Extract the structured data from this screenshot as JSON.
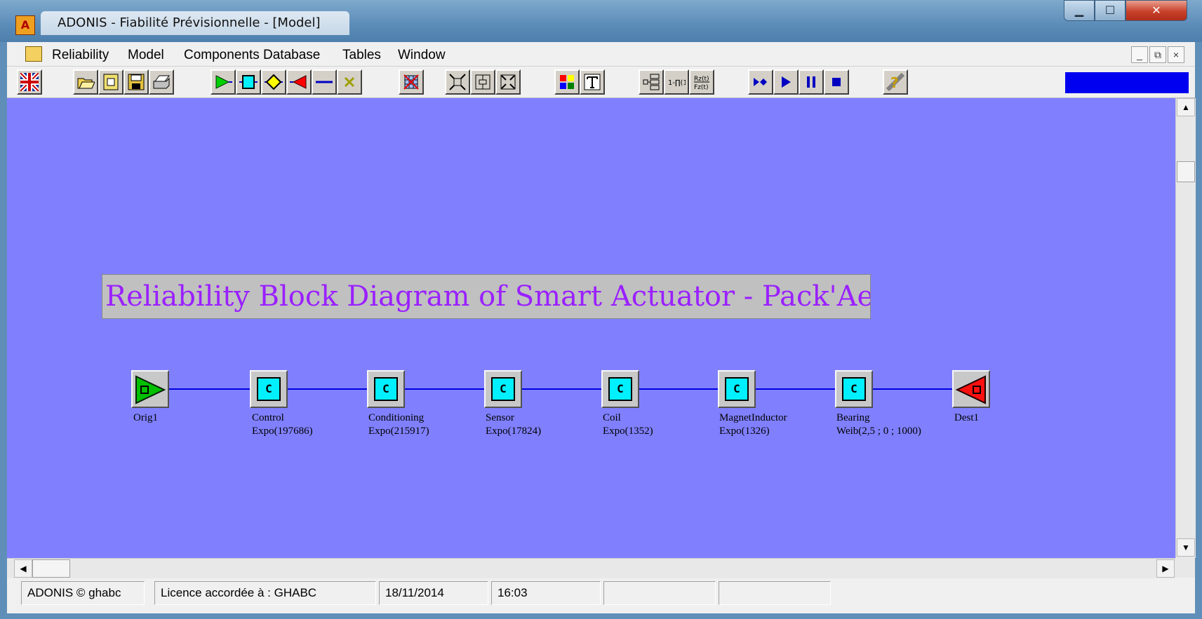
{
  "window": {
    "title": "ADONIS - Fiabilité Prévisionnelle - [Model]"
  },
  "menubar": {
    "items": [
      "Reliability",
      "Model",
      "Components Database",
      "Tables",
      "Window"
    ]
  },
  "toolbar": {
    "buttons": [
      {
        "name": "language-flag-button",
        "icon": "uk-flag-icon"
      },
      {
        "name": "open-button",
        "icon": "open-folder-icon"
      },
      {
        "name": "new-button",
        "icon": "new-document-icon"
      },
      {
        "name": "save-button",
        "icon": "floppy-disk-icon"
      },
      {
        "name": "print-button",
        "icon": "printer-icon"
      },
      {
        "name": "origin-tool-button",
        "icon": "origin-triangle-icon"
      },
      {
        "name": "component-tool-button",
        "icon": "component-square-icon"
      },
      {
        "name": "node-tool-button",
        "icon": "diamond-node-icon"
      },
      {
        "name": "destination-tool-button",
        "icon": "destination-triangle-icon"
      },
      {
        "name": "link-tool-button",
        "icon": "link-line-icon"
      },
      {
        "name": "delete-button",
        "icon": "delete-x-icon"
      },
      {
        "name": "delete-all-button",
        "icon": "grid-delete-icon"
      },
      {
        "name": "zoom-in-button",
        "icon": "zoom-in-icon"
      },
      {
        "name": "center-button",
        "icon": "center-icon"
      },
      {
        "name": "zoom-out-button",
        "icon": "zoom-out-icon"
      },
      {
        "name": "colors-button",
        "icon": "color-palette-icon"
      },
      {
        "name": "text-button",
        "icon": "text-t-icon"
      },
      {
        "name": "structure-button",
        "icon": "structure-icon"
      },
      {
        "name": "function-button",
        "icon": "function-icon"
      },
      {
        "name": "reliability-functions-button",
        "icon": "rz-fz-icon"
      },
      {
        "name": "step-button",
        "icon": "step-icon"
      },
      {
        "name": "play-button",
        "icon": "play-icon"
      },
      {
        "name": "pause-button",
        "icon": "pause-icon"
      },
      {
        "name": "stop-button",
        "icon": "stop-icon"
      },
      {
        "name": "help-button",
        "icon": "help-question-icon"
      }
    ]
  },
  "diagram": {
    "title": "Reliability Block Diagram of Smart Actuator - Pack'Aero",
    "blocks": [
      {
        "type": "origin",
        "name": "Orig1",
        "law": ""
      },
      {
        "type": "component",
        "symbol": "C",
        "name": "Control",
        "law": "Expo(197686)"
      },
      {
        "type": "component",
        "symbol": "C",
        "name": "Conditioning",
        "law": "Expo(215917)"
      },
      {
        "type": "component",
        "symbol": "C",
        "name": "Sensor",
        "law": "Expo(17824)"
      },
      {
        "type": "component",
        "symbol": "C",
        "name": "Coil",
        "law": "Expo(1352)"
      },
      {
        "type": "component",
        "symbol": "C",
        "name": "MagnetInductor",
        "law": "Expo(1326)"
      },
      {
        "type": "component",
        "symbol": "C",
        "name": "Bearing",
        "law": "Weib(2,5 ; 0 ; 1000)"
      },
      {
        "type": "destination",
        "name": "Dest1",
        "law": ""
      }
    ]
  },
  "statusbar": {
    "copyright": "ADONIS © ghabc",
    "licence": "Licence accordée à : GHABC",
    "date": "18/11/2014",
    "time": "16:03"
  },
  "colors": {
    "canvas": "#8080ff",
    "component": "#00f0ff",
    "origin": "#00c000",
    "destination": "#ff2020",
    "title_text": "#9a20ff",
    "link": "#0000e0"
  }
}
